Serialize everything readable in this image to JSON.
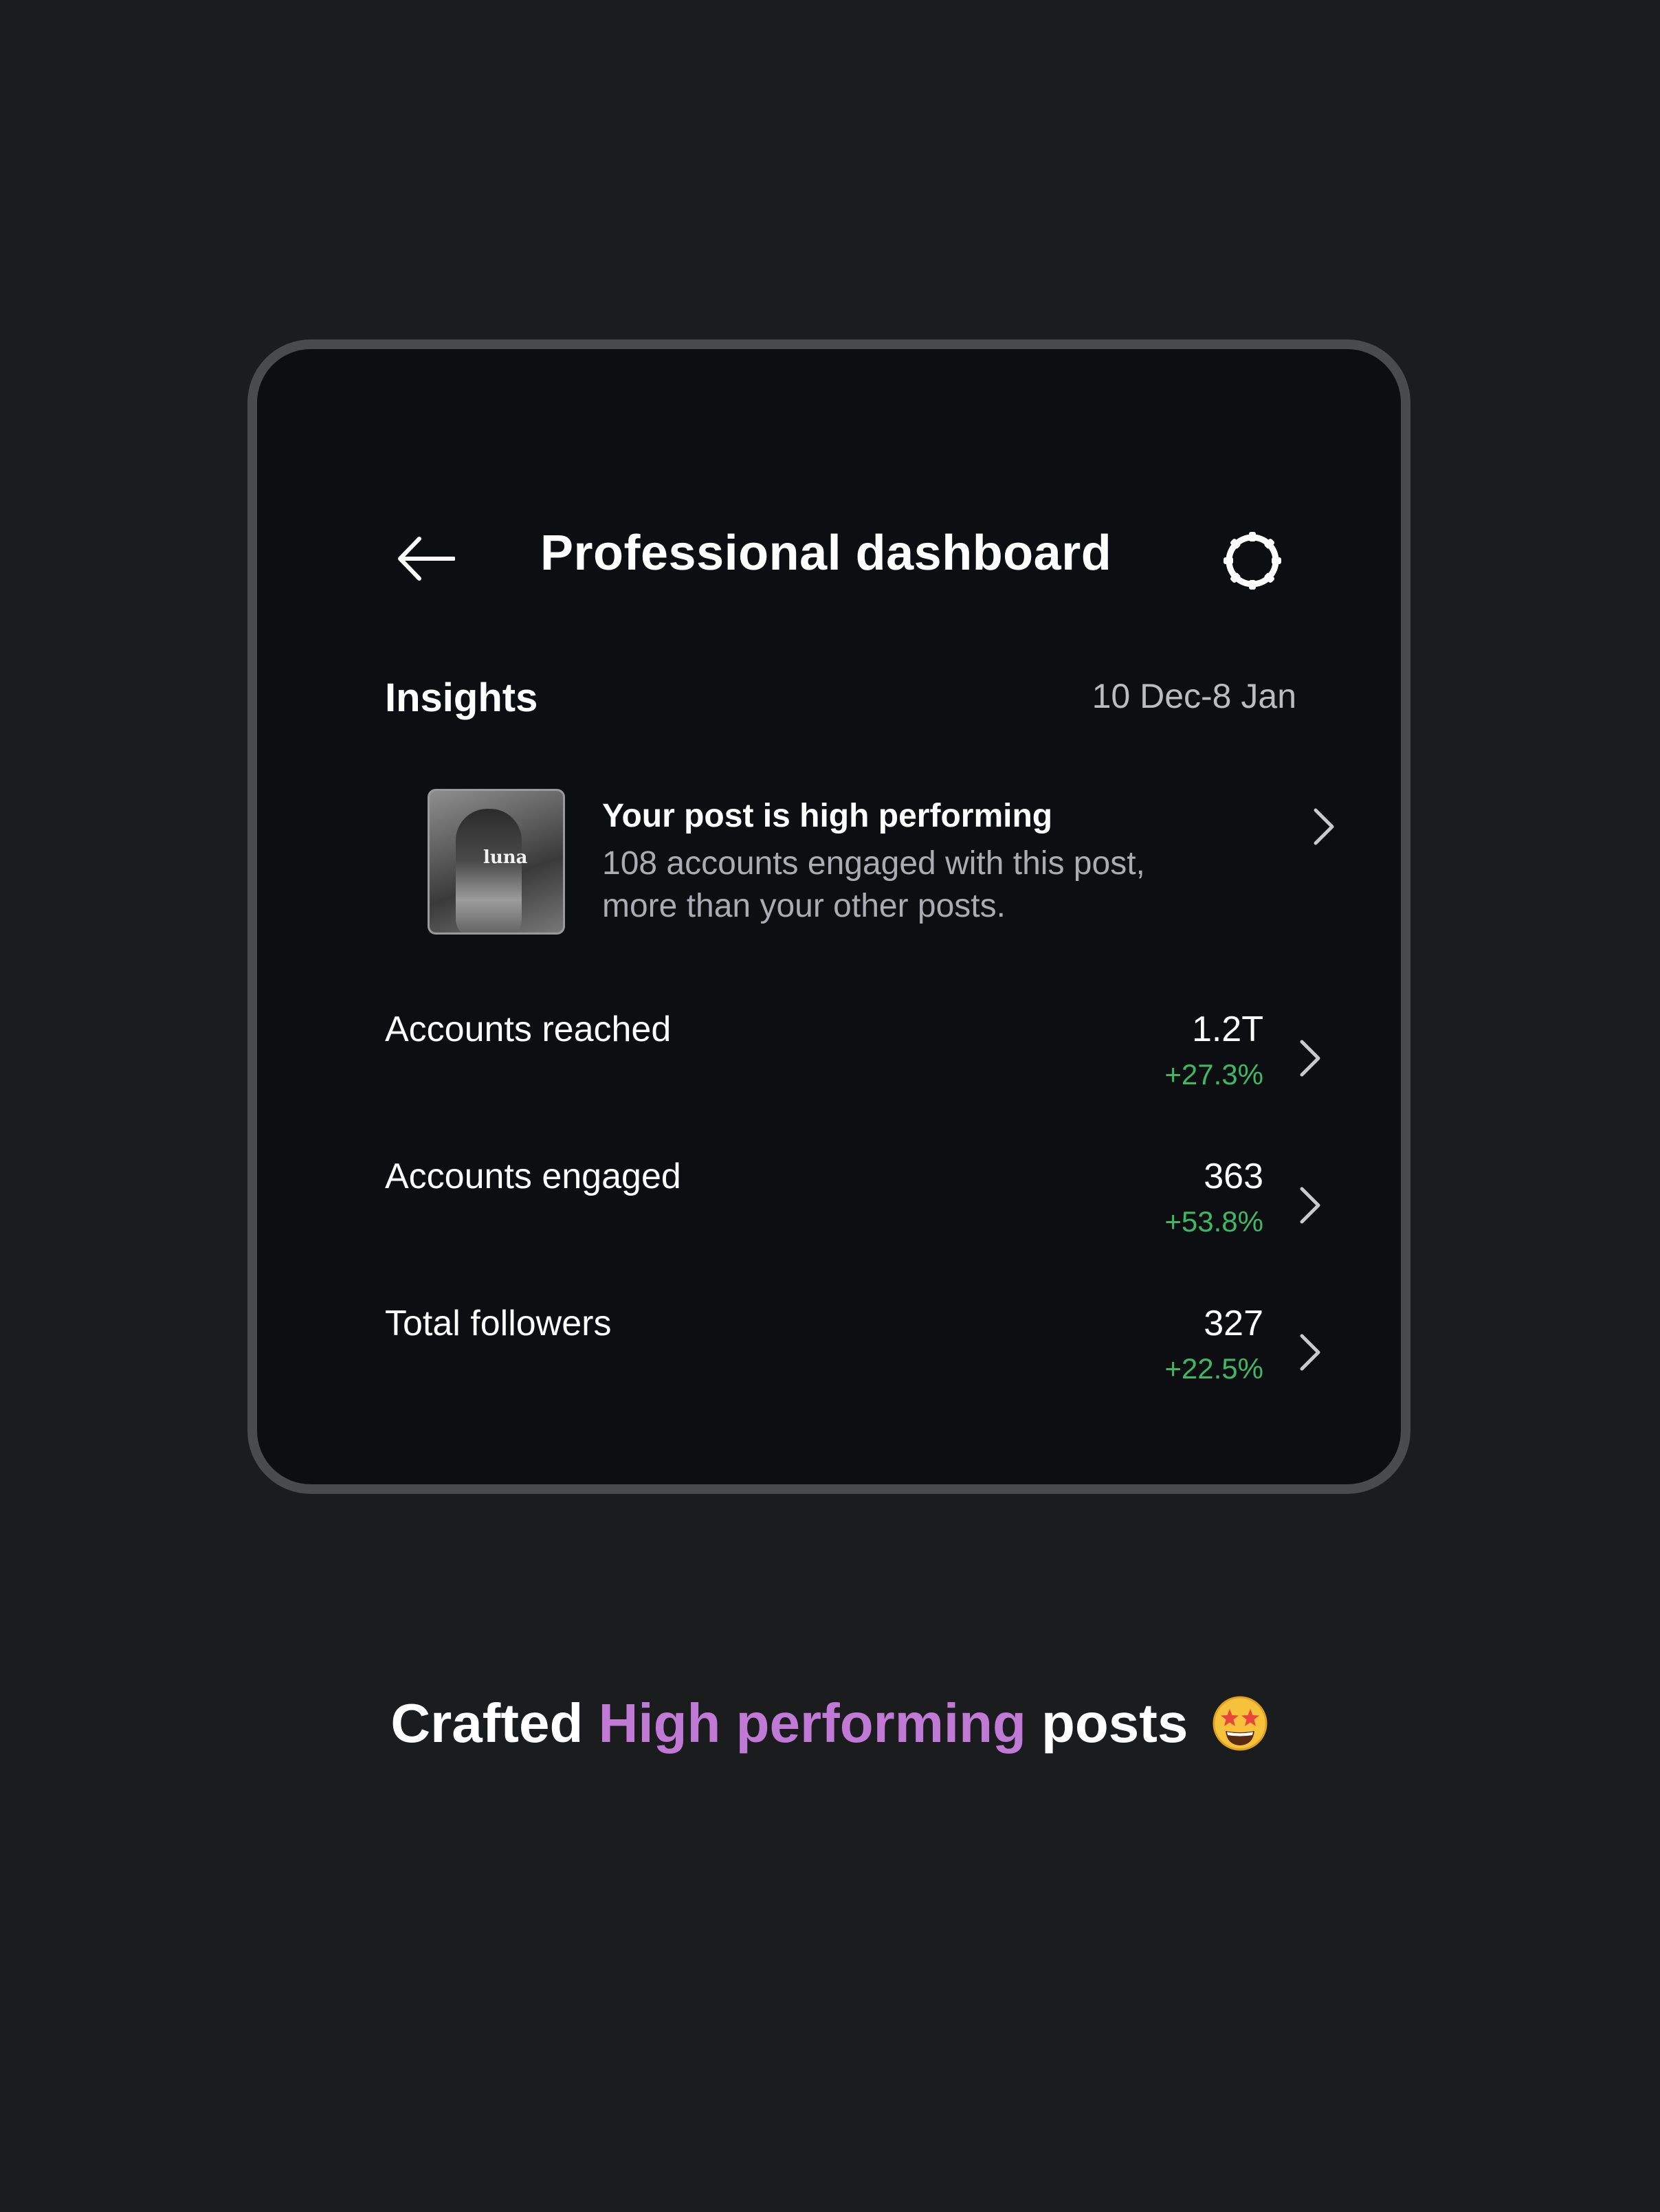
{
  "header": {
    "title": "Professional dashboard",
    "back_icon": "arrow-left-icon",
    "settings_icon": "gear-icon"
  },
  "insights": {
    "heading": "Insights",
    "date_range": "10 Dec-8 Jan"
  },
  "highlight": {
    "title": "Your post is high performing",
    "description": "108 accounts engaged with this post, more than your other posts.",
    "thumbnail_text": "luna"
  },
  "metrics": [
    {
      "label": "Accounts reached",
      "value": "1.2T",
      "change": "+27.3%"
    },
    {
      "label": "Accounts engaged",
      "value": "363",
      "change": "+53.8%"
    },
    {
      "label": "Total followers",
      "value": "327",
      "change": "+22.5%"
    }
  ],
  "caption": {
    "prefix": "Crafted",
    "highlight": "High performing",
    "suffix": "posts",
    "emoji": "star-struck-emoji"
  },
  "colors": {
    "background": "#1b1c1e",
    "card": "#0c0e12",
    "frame": "#4a4b4f",
    "positive_change": "#3fb865",
    "caption_highlight": "#c07ad6"
  }
}
